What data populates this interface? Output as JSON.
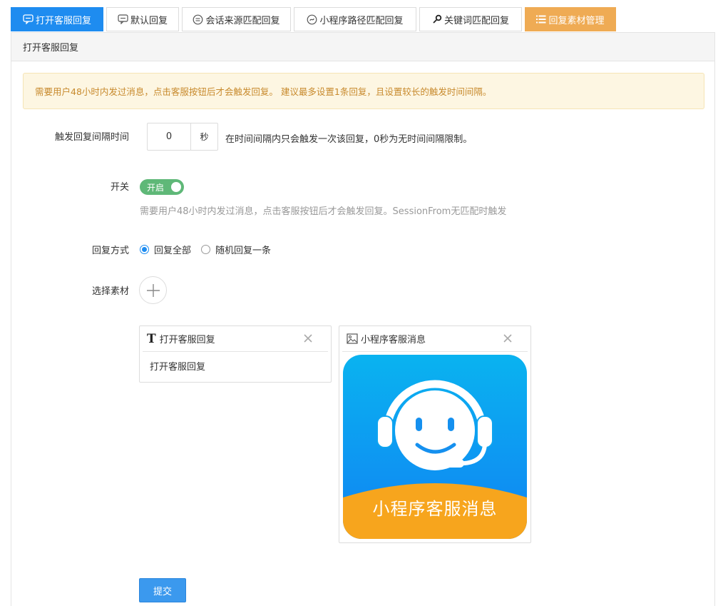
{
  "tabs": [
    {
      "label": "打开客服回复",
      "icon": "chat-bubble-icon",
      "state": "active"
    },
    {
      "label": "默认回复",
      "icon": "comment-icon",
      "state": "normal"
    },
    {
      "label": "会话来源匹配回复",
      "icon": "dialog-icon",
      "state": "normal"
    },
    {
      "label": "小程序路径匹配回复",
      "icon": "mini-program-icon",
      "state": "normal"
    },
    {
      "label": "关键词匹配回复",
      "icon": "key-icon",
      "state": "normal"
    },
    {
      "label": "回复素材管理",
      "icon": "list-icon",
      "state": "accent"
    }
  ],
  "panel": {
    "title": "打开客服回复",
    "notice": "需要用户48小时内发过消息，点击客服按钮后才会触发回复。 建议最多设置1条回复，且设置较长的触发时间间隔。"
  },
  "form": {
    "interval": {
      "label": "触发回复间隔时间",
      "value": "0",
      "unit": "秒",
      "hint": "在时间间隔内只会触发一次该回复，0秒为无时间间隔限制。"
    },
    "switch": {
      "label": "开关",
      "state_text": "开启",
      "hint": "需要用户48小时内发过消息，点击客服按钮后才会触发回复。SessionFrom无匹配时触发"
    },
    "reply_mode": {
      "label": "回复方式",
      "options": [
        "回复全部",
        "随机回复一条"
      ],
      "selected": "回复全部"
    },
    "material": {
      "label": "选择素材"
    },
    "submit_label": "提交"
  },
  "materials": [
    {
      "type": "text",
      "icon": "text-type-icon",
      "title": "打开客服回复",
      "body": "打开客服回复"
    },
    {
      "type": "image",
      "icon": "image-icon",
      "title": "小程序客服消息",
      "image_caption": "小程序客服消息"
    }
  ],
  "colors": {
    "primary": "#1e8cf0",
    "accent_tab": "#efab54",
    "switch_on": "#5fb878",
    "notice_bg": "#fdf6e2",
    "notice_text": "#c88a2d"
  }
}
